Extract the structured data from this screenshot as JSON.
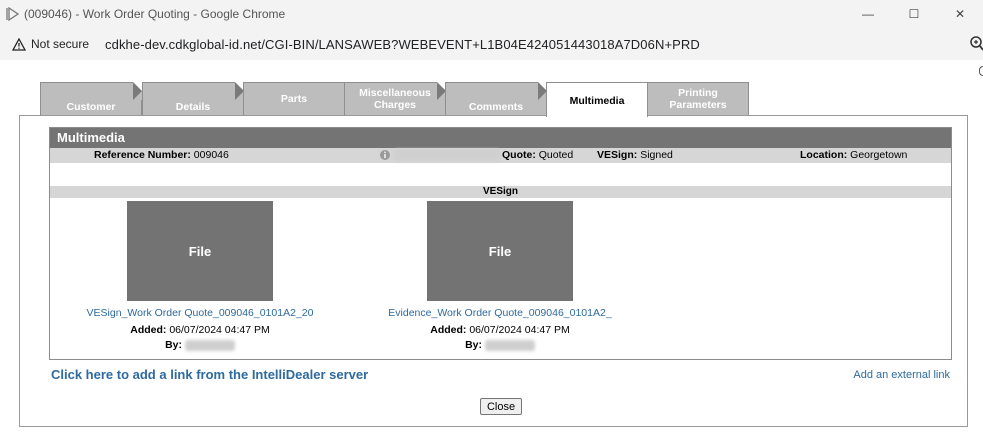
{
  "window": {
    "title": "(009046) - Work Order Quoting - Google Chrome",
    "controls": {
      "minimize": "—",
      "maximize": "☐",
      "close": "✕"
    }
  },
  "addressbar": {
    "security_label": "Not secure",
    "url": "cdkhe-dev.cdkglobal-id.net/CGI-BIN/LANSAWEB?WEBEVENT+L1B04E424051443018A7D06N+PRD"
  },
  "tabs": [
    {
      "label": "Customer",
      "active": false
    },
    {
      "label": "Details",
      "active": false
    },
    {
      "label": "Parts",
      "active": false
    },
    {
      "label": "Miscellaneous Charges",
      "active": false
    },
    {
      "label": "Comments",
      "active": false
    },
    {
      "label": "Multimedia",
      "active": true
    },
    {
      "label": "Printing Parameters",
      "active": false
    }
  ],
  "multimedia": {
    "header": "Multimedia",
    "info": {
      "reference_label": "Reference Number:",
      "reference_value": "009046",
      "quote_label": "Quote:",
      "quote_value": "Quoted",
      "vesign_label": "VESign:",
      "vesign_value": "Signed",
      "location_label": "Location:",
      "location_value": "Georgetown"
    },
    "section_title": "VESign",
    "files": [
      {
        "thumb_label": "File",
        "link": "VESign_Work Order Quote_009046_0101A2_20",
        "added_label": "Added:",
        "added_value": "06/07/2024 04:47 PM",
        "by_label": "By:"
      },
      {
        "thumb_label": "File",
        "link": "Evidence_Work Order Quote_009046_0101A2_",
        "added_label": "Added:",
        "added_value": "06/07/2024 04:47 PM",
        "by_label": "By:"
      }
    ]
  },
  "links": {
    "intellidealer": "Click here to add a link from the IntelliDealer server",
    "external": "Add an external link"
  },
  "buttons": {
    "close": "Close"
  },
  "colors": {
    "link": "#2d6a9f",
    "header_bg": "#747474",
    "tab_bg": "#bdbdbd",
    "file_thumb": "#737373"
  }
}
